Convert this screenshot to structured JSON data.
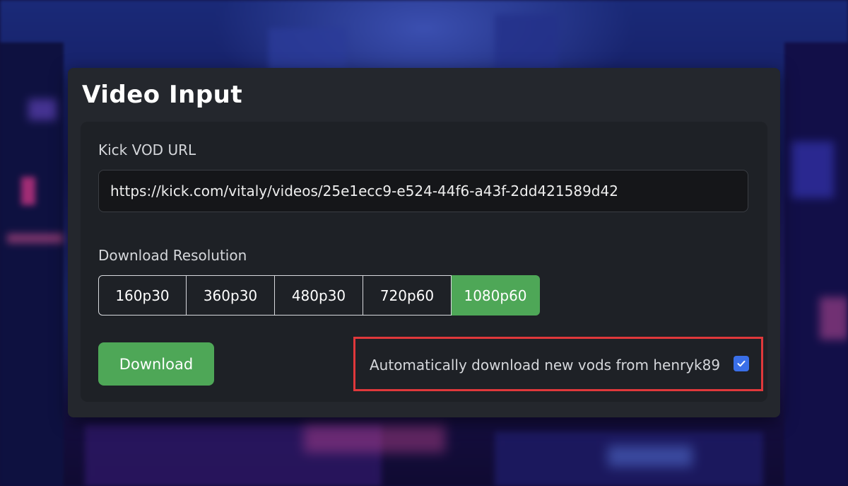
{
  "panel": {
    "title": "Video Input"
  },
  "url_field": {
    "label": "Kick VOD URL",
    "value": "https://kick.com/vitaly/videos/25e1ecc9-e524-44f6-a43f-2dd421589d42"
  },
  "resolution": {
    "label": "Download Resolution",
    "options": [
      "160p30",
      "360p30",
      "480p30",
      "720p60",
      "1080p60"
    ],
    "selected": "1080p60"
  },
  "actions": {
    "download_label": "Download"
  },
  "auto_download": {
    "label": "Automatically download new vods from henryk89",
    "checked": true
  },
  "colors": {
    "accent_green": "#4ea757",
    "checkbox_blue": "#3a6fe8",
    "highlight_red": "#e0383b",
    "panel_bg": "#24272d",
    "inner_bg": "#1e2126"
  }
}
